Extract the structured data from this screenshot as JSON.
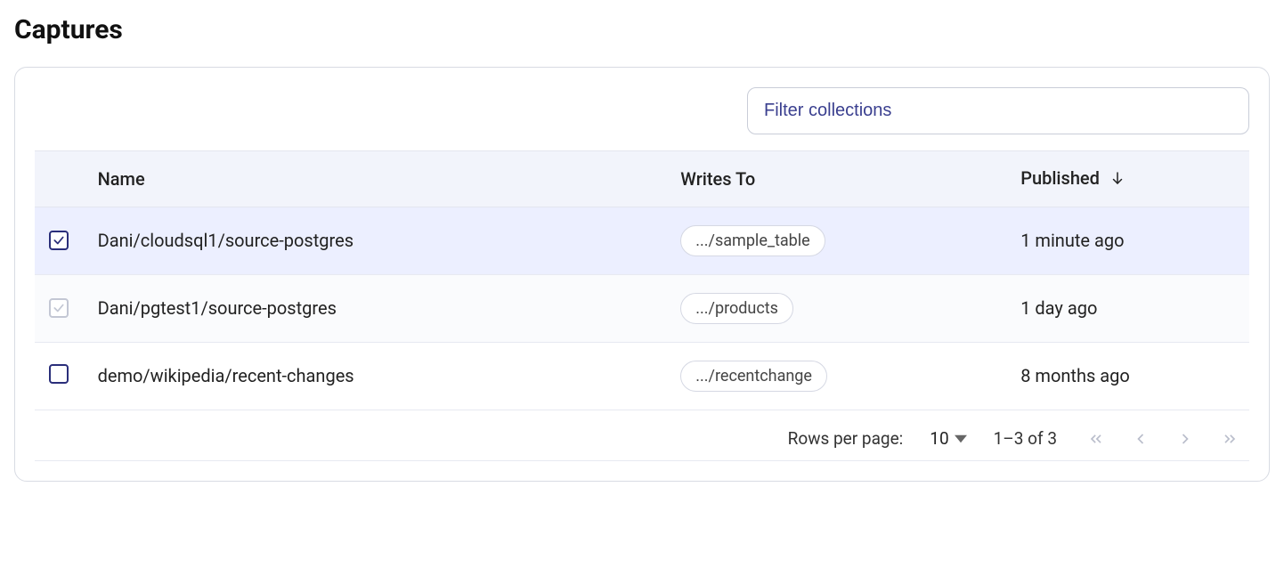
{
  "title": "Captures",
  "filter": {
    "placeholder": "Filter collections"
  },
  "columns": {
    "name": "Name",
    "writes_to": "Writes To",
    "published": "Published"
  },
  "rows": [
    {
      "name": "Dani/cloudsql1/source-postgres",
      "writes_to": ".../sample_table",
      "published": "1 minute ago",
      "selected": true,
      "checkbox_state": "checked"
    },
    {
      "name": "Dani/pgtest1/source-postgres",
      "writes_to": ".../products",
      "published": "1 day ago",
      "selected": false,
      "checkbox_state": "disabled-checked"
    },
    {
      "name": "demo/wikipedia/recent-changes",
      "writes_to": ".../recentchange",
      "published": "8 months ago",
      "selected": false,
      "checkbox_state": "unchecked"
    }
  ],
  "pagination": {
    "rows_label": "Rows per page:",
    "rows_value": "10",
    "range": "1–3 of 3"
  }
}
